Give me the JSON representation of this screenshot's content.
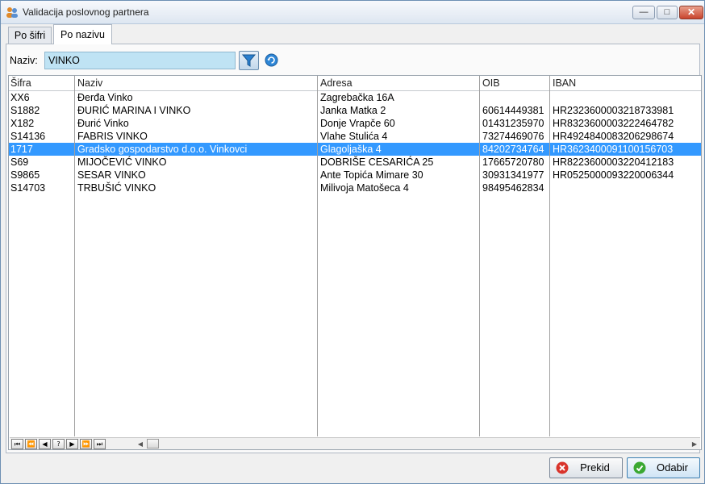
{
  "window": {
    "title": "Validacija poslovnog partnera"
  },
  "tabs": [
    {
      "label": "Po šifri",
      "active": false
    },
    {
      "label": "Po nazivu",
      "active": true
    }
  ],
  "search": {
    "label": "Naziv:",
    "value": "VINKO"
  },
  "grid": {
    "columns": [
      "Šifra",
      "Naziv",
      "Adresa",
      "OIB",
      "IBAN"
    ],
    "rows": [
      {
        "sifra": "XX6",
        "naziv": "Đerđa Vinko",
        "adresa": "Zagrebačka 16A",
        "oib": "",
        "iban": ""
      },
      {
        "sifra": "S1882",
        "naziv": "ĐURIĆ MARINA I VINKO",
        "adresa": "Janka Matka 2",
        "oib": "60614449381",
        "iban": "HR2323600003218733981"
      },
      {
        "sifra": "X182",
        "naziv": "Đurić Vinko",
        "adresa": "Donje Vrapče 60",
        "oib": "01431235970",
        "iban": "HR8323600003222464782"
      },
      {
        "sifra": "S14136",
        "naziv": "FABRIS VINKO",
        "adresa": "Vlahe Stulića 4",
        "oib": "73274469076",
        "iban": "HR4924840083206298674"
      },
      {
        "sifra": "1717",
        "naziv": "Gradsko gospodarstvo d.o.o. Vinkovci",
        "adresa": "Glagoljaška 4",
        "oib": "84202734764",
        "iban": "HR3623400091100156703",
        "selected": true
      },
      {
        "sifra": "S69",
        "naziv": "MIJOČEVIĆ VINKO",
        "adresa": "DOBRIŠE CESARIĆA 25",
        "oib": "17665720780",
        "iban": "HR8223600003220412183"
      },
      {
        "sifra": "S9865",
        "naziv": "SESAR VINKO",
        "adresa": "Ante Topića Mimare 30",
        "oib": "30931341977",
        "iban": "HR0525000093220006344"
      },
      {
        "sifra": "S14703",
        "naziv": "TRBUŠIĆ VINKO",
        "adresa": "Milivoja Matošeca 4",
        "oib": "98495462834",
        "iban": ""
      }
    ]
  },
  "navigator": {
    "buttons": [
      {
        "name": "nav-first-icon",
        "glyph": "⏮"
      },
      {
        "name": "nav-prev-page-icon",
        "glyph": "⏪"
      },
      {
        "name": "nav-prev-icon",
        "glyph": "◀"
      },
      {
        "name": "nav-help-icon",
        "glyph": "?"
      },
      {
        "name": "nav-next-icon",
        "glyph": "▶"
      },
      {
        "name": "nav-next-page-icon",
        "glyph": "⏩"
      },
      {
        "name": "nav-last-icon",
        "glyph": "⏭"
      }
    ]
  },
  "buttons": {
    "cancel": "Prekid",
    "select": "Odabir"
  },
  "colors": {
    "selection": "#3399ff",
    "search_bg": "#bfe3f4",
    "cancel_icon": "#d9342b",
    "ok_icon": "#3aa832"
  }
}
